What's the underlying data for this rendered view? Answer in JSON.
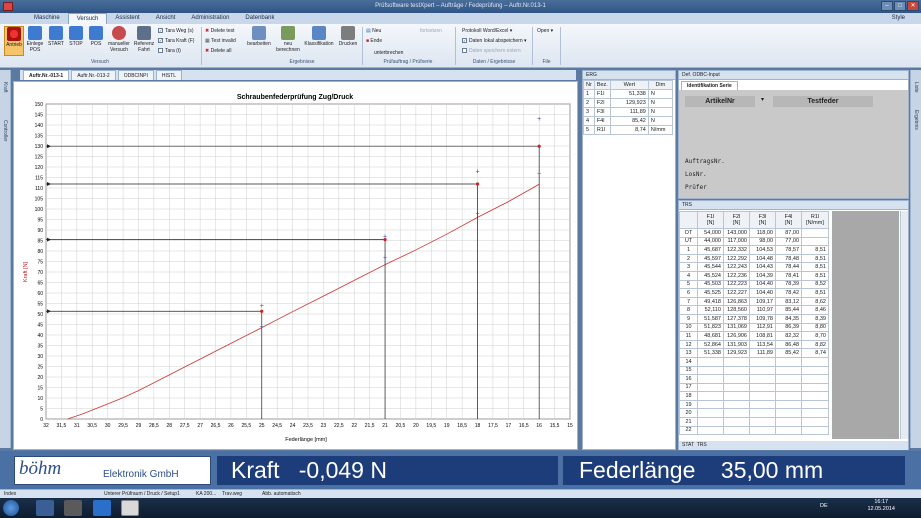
{
  "window": {
    "title": "Prüfsoftware testXpert – Aufträge / Fedeprüfung – Auftr.Nr.013-1",
    "style_label": "Style"
  },
  "ribbon": {
    "tabs": [
      "Maschine",
      "Versuch",
      "Assistent",
      "Ansicht",
      "Administration",
      "Datenbank"
    ],
    "active_tab": "Versuch",
    "buttons": {
      "antrieb": "Antrieb",
      "einlege": "Einlege POS",
      "start": "START",
      "stop": "STOP",
      "pos": "POS",
      "manuell": "manueller Versuch",
      "referenz": "Referenz Fahrt",
      "bearbeiten": "bearbeiten",
      "neu_berechnen": "neu berechnen",
      "klassifikation": "Klassifikation",
      "drucken": "Drucken",
      "open": "Open"
    },
    "checks": {
      "tara_weg": "Tara Weg (s)",
      "tara_kraft": "Tara Kraft (F)",
      "tara_t": "Tara (t)"
    },
    "delete": {
      "test": "Delete test",
      "invalid": "Test invalid",
      "all": "Delete all"
    },
    "pruef": {
      "neu": "Neu",
      "ende": "Ende",
      "unterbrechen": "unterbrechen",
      "fortsetzen": "fortsetzen"
    },
    "daten": {
      "protokoll": "Protokoll Word/Excel",
      "lokal": "Daten lokal abspeichern",
      "extern": "Daten speichern extern"
    },
    "groups": {
      "versuch": "Versuch",
      "ergebnisse": "Ergebnisse",
      "pruef": "Prüfauftrag / Prüfserie",
      "daten": "Daten / Ergebnisse",
      "file": "File"
    }
  },
  "doc_tabs": [
    "Auftr.Nr.-013-1",
    "Auftr.Nr.-013-2",
    "ODBCINPI",
    "HISTL"
  ],
  "chart_data": {
    "type": "line",
    "title": "Schraubenfederprüfung Zug/Druck",
    "xlabel": "Federlänge [mm]",
    "ylabel": "Kraft [N]",
    "xlim": [
      32,
      15
    ],
    "ylim": [
      0,
      150
    ],
    "x_ticks": [
      32,
      31.5,
      31,
      30.5,
      30,
      29.5,
      29,
      28.5,
      28,
      27.5,
      27,
      26.5,
      26,
      25.5,
      25,
      24.5,
      24,
      23.5,
      23,
      22.5,
      22,
      21.5,
      21,
      20.5,
      20,
      19.5,
      19,
      18.5,
      18,
      17.5,
      17,
      16.5,
      16,
      15.5,
      15
    ],
    "x_tick_labels": [
      "32",
      "31,5",
      "31",
      "30,5",
      "30",
      "29,5",
      "29",
      "28,5",
      "28",
      "27,5",
      "27",
      "26,5",
      "26",
      "25,5",
      "25",
      "24,5",
      "24",
      "23,5",
      "23",
      "22,5",
      "22",
      "21,5",
      "21",
      "20,5",
      "20",
      "19,5",
      "19",
      "18,5",
      "18",
      "17,5",
      "17",
      "16,5",
      "16",
      "15,5",
      "15"
    ],
    "y_ticks": [
      0,
      5,
      10,
      15,
      20,
      25,
      30,
      35,
      40,
      45,
      50,
      55,
      60,
      65,
      70,
      75,
      80,
      85,
      90,
      95,
      100,
      105,
      110,
      115,
      120,
      125,
      130,
      135,
      140,
      145,
      150
    ],
    "curve": {
      "x": [
        31.3,
        30.8,
        30.2,
        29.6,
        29,
        28,
        27,
        26,
        25,
        24,
        23,
        22,
        21,
        20,
        19,
        18,
        17,
        16
      ],
      "y": [
        0,
        2.5,
        6,
        9.5,
        13.5,
        21,
        28.5,
        36,
        43.5,
        51.1,
        58.5,
        66,
        73.5,
        80.5,
        88,
        96,
        103.5,
        111.8,
        120,
        128,
        130
      ]
    },
    "measure_points": [
      {
        "x": 25,
        "y": 51.3
      },
      {
        "x": 21,
        "y": 85.4
      },
      {
        "x": 18,
        "y": 111.9
      },
      {
        "x": 16,
        "y": 129.9
      }
    ],
    "upper_tolerance": [
      {
        "x": 25,
        "y": 54
      },
      {
        "x": 21,
        "y": 87
      },
      {
        "x": 18,
        "y": 118
      },
      {
        "x": 16,
        "y": 143
      }
    ],
    "lower_tolerance": [
      {
        "x": 25,
        "y": 44
      },
      {
        "x": 21,
        "y": 77
      },
      {
        "x": 18,
        "y": 98
      },
      {
        "x": 16,
        "y": 117
      }
    ],
    "grid": true
  },
  "erg": {
    "title": "ERG",
    "columns": [
      "Nr",
      "Bez.",
      "Wert",
      "Dim"
    ],
    "rows": [
      [
        "1",
        "F1l",
        "51,338",
        "N"
      ],
      [
        "2",
        "F2l",
        "129,923",
        "N"
      ],
      [
        "3",
        "F3l",
        "111,89",
        "N"
      ],
      [
        "4",
        "F4l",
        "85,42",
        "N"
      ],
      [
        "5",
        "R1l",
        "8,74",
        "N/mm"
      ]
    ]
  },
  "ident": {
    "panel_title": "Def. ODBC-Input",
    "tab": "Identifikation Serie",
    "artikel_label": "ArtikelNr",
    "artikel_value": "Testfeder",
    "auftrag": "AuftragsNr.",
    "los": "LosNr.",
    "pruefer": "Prüfer"
  },
  "trs": {
    "title": "TRS",
    "columns": [
      [
        "F1l",
        "[N]"
      ],
      [
        "F2l",
        "[N]"
      ],
      [
        "F3l",
        "[N]"
      ],
      [
        "F4l",
        "[N]"
      ],
      [
        "R1l",
        "[N/mm]"
      ]
    ],
    "ot": [
      "OT",
      "54,000",
      "143,000",
      "118,00",
      "87,00",
      ""
    ],
    "ut": [
      "UT",
      "44,000",
      "117,000",
      "98,00",
      "77,00",
      ""
    ],
    "rows": [
      [
        "1",
        "45,687",
        "122,332",
        "104,53",
        "78,57",
        "8,51"
      ],
      [
        "2",
        "45,597",
        "122,292",
        "104,48",
        "78,48",
        "8,51"
      ],
      [
        "3",
        "45,544",
        "122,243",
        "104,43",
        "78,44",
        "8,51"
      ],
      [
        "4",
        "45,524",
        "122,236",
        "104,39",
        "78,41",
        "8,51"
      ],
      [
        "5",
        "45,503",
        "122,223",
        "104,40",
        "78,39",
        "8,52"
      ],
      [
        "6",
        "45,525",
        "122,227",
        "104,40",
        "78,42",
        "8,51"
      ],
      [
        "7",
        "49,418",
        "126,863",
        "109,17",
        "83,12",
        "8,62"
      ],
      [
        "8",
        "52,110",
        "128,560",
        "110,97",
        "85,44",
        "8,46"
      ],
      [
        "9",
        "51,587",
        "127,378",
        "109,78",
        "84,35",
        "8,39"
      ],
      [
        "10",
        "51,823",
        "131,069",
        "112,91",
        "86,39",
        "8,80"
      ],
      [
        "11",
        "48,681",
        "126,906",
        "108,81",
        "82,32",
        "8,70"
      ],
      [
        "12",
        "52,864",
        "131,903",
        "113,54",
        "86,48",
        "8,82"
      ],
      [
        "13",
        "51,338",
        "129,923",
        "111,89",
        "85,42",
        "8,74"
      ],
      [
        "14",
        "",
        "",
        "",
        "",
        ""
      ],
      [
        "15",
        "",
        "",
        "",
        "",
        ""
      ],
      [
        "16",
        "",
        "",
        "",
        "",
        ""
      ],
      [
        "17",
        "",
        "",
        "",
        "",
        ""
      ],
      [
        "18",
        "",
        "",
        "",
        "",
        ""
      ],
      [
        "19",
        "",
        "",
        "",
        "",
        ""
      ],
      [
        "20",
        "",
        "",
        "",
        "",
        ""
      ],
      [
        "21",
        "",
        "",
        "",
        "",
        ""
      ],
      [
        "22",
        "",
        "",
        "",
        "",
        ""
      ]
    ],
    "tab_stat": "STAT",
    "tab_trs": "TRS"
  },
  "banner": {
    "logo_main": "böhm",
    "logo_sub": "Elektronik GmbH",
    "kraft_label": "Kraft",
    "kraft_value": "-0,049 N",
    "feder_label": "Federlänge",
    "feder_value": "35,00 mm"
  },
  "statusbar": {
    "index": "Index",
    "pruefraum": "Unterer Prüfraum / Druck / Setup1",
    "ka": "KA 200...",
    "weg": "Trav.weg",
    "abb": "Abb. automatisch"
  },
  "taskbar": {
    "time": "16:17",
    "date": "12.05.2014",
    "lang": "DE"
  },
  "side": {
    "left1": "Kraft",
    "left2": "Controller",
    "right1": "Liste",
    "right2": "Ergebnis"
  }
}
